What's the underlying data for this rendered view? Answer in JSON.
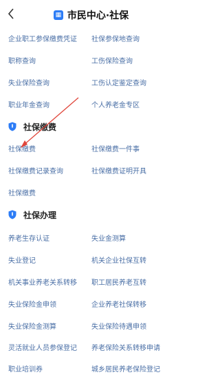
{
  "header": {
    "title": "市民中心·社保",
    "logo_glyph": "▦",
    "back_icon": "chevron-left-icon"
  },
  "top_rows": [
    [
      "企业职工参保缴费凭证",
      "社保参保地查询"
    ],
    [
      "职称查询",
      "工伤保险查询"
    ],
    [
      "失业保险查询",
      "工伤认定鉴定查询"
    ],
    [
      "职业年金查询",
      "个人养老金专区"
    ]
  ],
  "section_payment": {
    "title": "社保缴费",
    "rows": [
      [
        "社保缴费",
        "社保缴费一件事"
      ],
      [
        "社保缴费记录查询",
        "社保缴费证明开具"
      ],
      [
        "社保缴费",
        ""
      ]
    ]
  },
  "section_handle": {
    "title": "社保办理",
    "rows": [
      [
        "养老生存认证",
        "失业金测算"
      ],
      [
        "失业登记",
        "机关企业社保互转"
      ],
      [
        "机关事业养老关系转移",
        "职工居民养老互转"
      ],
      [
        "失业保险金申领",
        "企业养老社保转移"
      ],
      [
        "失业保险金测算",
        "失业保险待遇申领"
      ],
      [
        "灵活就业人员参保登记",
        "养老保险关系转移申请"
      ],
      [
        "职业培训券",
        "城乡居民养老保险登记"
      ]
    ]
  },
  "colors": {
    "link": "#4a6fa6",
    "accent": "#2c7cf6",
    "annotation_arrow": "#e0453a"
  }
}
